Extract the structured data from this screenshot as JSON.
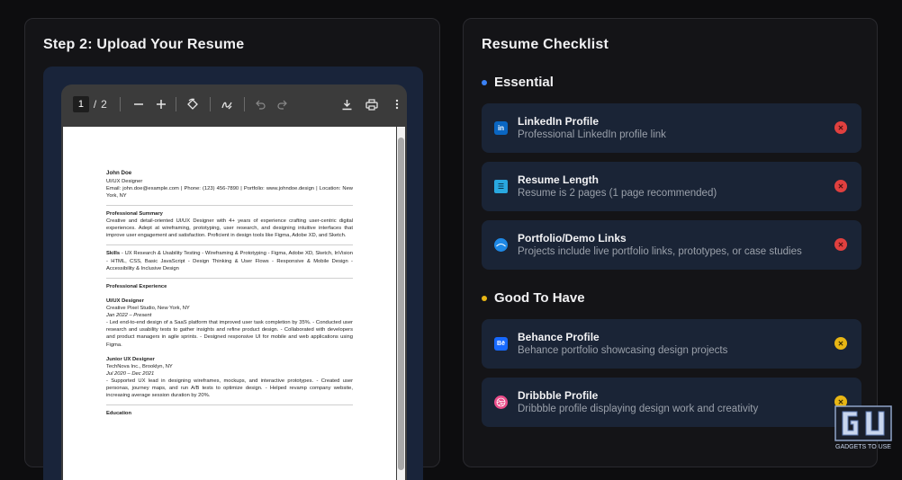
{
  "left": {
    "title": "Step 2: Upload Your Resume",
    "pdf": {
      "current_page": "1",
      "page_sep": "/",
      "total_pages": "2"
    }
  },
  "resume": {
    "name": "John Doe",
    "role": "UI/UX Designer",
    "contact": "Email: john.doe@example.com | Phone: (123) 456-7890 | Portfolio: www.johndoe.design | Location: New York, NY",
    "summary_heading": "Professional Summary",
    "summary": "Creative and detail-oriented UI/UX Designer with 4+ years of experience crafting user-centric digital experiences. Adept at wireframing, prototyping, user research, and designing intuitive interfaces that improve user engagement and satisfaction. Proficient in design tools like Figma, Adobe XD, and Sketch.",
    "skills_label": "Skills",
    "skills": " - UX Research & Usability Testing - Wireframing & Prototyping - Figma, Adobe XD, Sketch, InVision - HTML, CSS, Basic JavaScript - Design Thinking & User Flows - Responsive & Mobile Design - Accessibility & Inclusive Design",
    "experience_heading": "Professional Experience",
    "job1_title": "UI/UX Designer",
    "job1_company": "Creative Pixel Studio, New York, NY",
    "job1_dates": "Jan 2022 – Present",
    "job1_desc": "- Led end-to-end design of a SaaS platform that improved user task completion by 35%. - Conducted user research and usability tests to gather insights and refine product design. - Collaborated with developers and product managers in agile sprints. - Designed responsive UI for mobile and web applications using Figma.",
    "job2_title": "Junior UX Designer",
    "job2_company": "TechNova Inc., Brooklyn, NY",
    "job2_dates": "Jul 2020 – Dec 2021",
    "job2_desc": "- Supported UX lead in designing wireframes, mockups, and interactive prototypes. - Created user personas, journey maps, and run A/B tests to optimize design. - Helped revamp company website, increasing average session duration by 20%.",
    "education_heading": "Education"
  },
  "right": {
    "title": "Resume Checklist",
    "essential": {
      "heading": "Essential",
      "dot_color": "#3b82f6",
      "items": [
        {
          "title": "LinkedIn Profile",
          "desc": "Professional LinkedIn profile link",
          "icon": "linkedin-icon",
          "status": "missing"
        },
        {
          "title": "Resume Length",
          "desc": "Resume is 2 pages (1 page recommended)",
          "icon": "document-icon",
          "status": "missing"
        },
        {
          "title": "Portfolio/Demo Links",
          "desc": "Projects include live portfolio links, prototypes, or case studies",
          "icon": "portfolio-icon",
          "status": "missing"
        }
      ]
    },
    "good": {
      "heading": "Good To Have",
      "dot_color": "#e8b614",
      "items": [
        {
          "title": "Behance Profile",
          "desc": "Behance portfolio showcasing design projects",
          "icon": "behance-icon",
          "status": "missing"
        },
        {
          "title": "Dribbble Profile",
          "desc": "Dribbble profile displaying design work and creativity",
          "icon": "dribbble-icon",
          "status": "missing"
        }
      ]
    }
  },
  "watermark": {
    "text": "GADGETS TO USE"
  }
}
